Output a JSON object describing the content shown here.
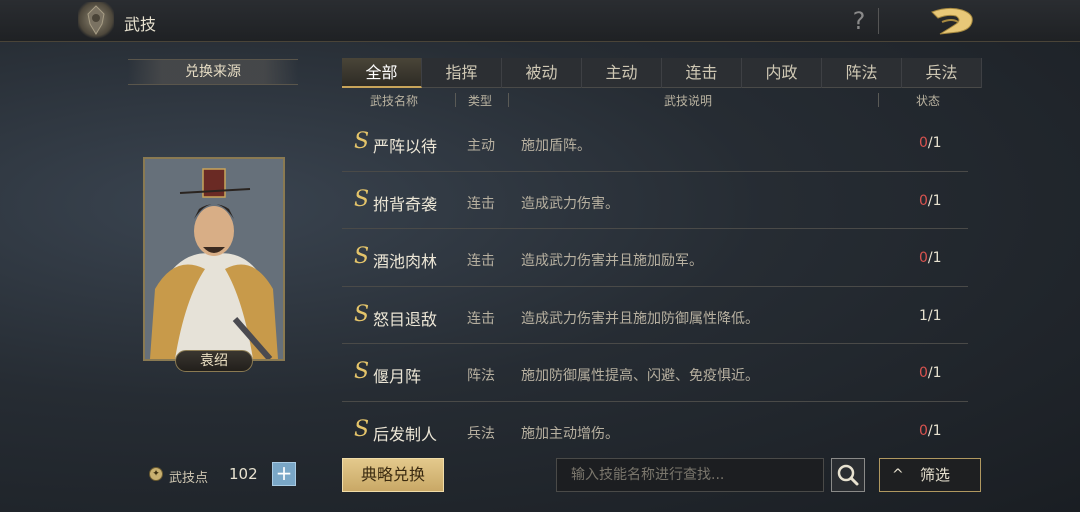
{
  "header": {
    "title": "武技",
    "help_label": "?"
  },
  "left_panel": {
    "source_label": "兑换来源",
    "hero_name": "袁绍",
    "points_label": "武技点",
    "points_value": "102",
    "plus_label": "+"
  },
  "tabs": [
    {
      "label": "全部",
      "active": true
    },
    {
      "label": "指挥",
      "active": false
    },
    {
      "label": "被动",
      "active": false
    },
    {
      "label": "主动",
      "active": false
    },
    {
      "label": "连击",
      "active": false
    },
    {
      "label": "内政",
      "active": false
    },
    {
      "label": "阵法",
      "active": false
    },
    {
      "label": "兵法",
      "active": false
    }
  ],
  "table": {
    "headers": {
      "name": "武技名称",
      "type": "类型",
      "desc": "武技说明",
      "status": "状态"
    },
    "rows": [
      {
        "grade": "S",
        "name": "严阵以待",
        "type": "主动",
        "desc": "施加盾阵。",
        "owned": "0",
        "total": "/1",
        "available": false
      },
      {
        "grade": "S",
        "name": "拊背奇袭",
        "type": "连击",
        "desc": "造成武力伤害。",
        "owned": "0",
        "total": "/1",
        "available": false
      },
      {
        "grade": "S",
        "name": "酒池肉林",
        "type": "连击",
        "desc": "造成武力伤害并且施加励军。",
        "owned": "0",
        "total": "/1",
        "available": false
      },
      {
        "grade": "S",
        "name": "怒目退敌",
        "type": "连击",
        "desc": "造成武力伤害并且施加防御属性降低。",
        "owned": "1",
        "total": "/1",
        "available": true
      },
      {
        "grade": "S",
        "name": "偃月阵",
        "type": "阵法",
        "desc": "施加防御属性提高、闪避、免疫惧近。",
        "owned": "0",
        "total": "/1",
        "available": false
      },
      {
        "grade": "S",
        "name": "后发制人",
        "type": "兵法",
        "desc": "施加主动增伤。",
        "owned": "0",
        "total": "/1",
        "available": false
      }
    ]
  },
  "bottom": {
    "exchange_label": "典略兑换",
    "search_placeholder": "输入技能名称进行查找...",
    "filter_chevron": "^",
    "filter_label": "筛选"
  },
  "colors": {
    "accent_gold": "#c8a45a",
    "unowned_red": "#d9534f",
    "grade_gold": "#e4c46a"
  },
  "icons": [
    "crest-icon",
    "help-icon",
    "back-dragon-icon",
    "points-coin-icon",
    "plus-icon",
    "search-icon",
    "chevron-up-icon"
  ]
}
